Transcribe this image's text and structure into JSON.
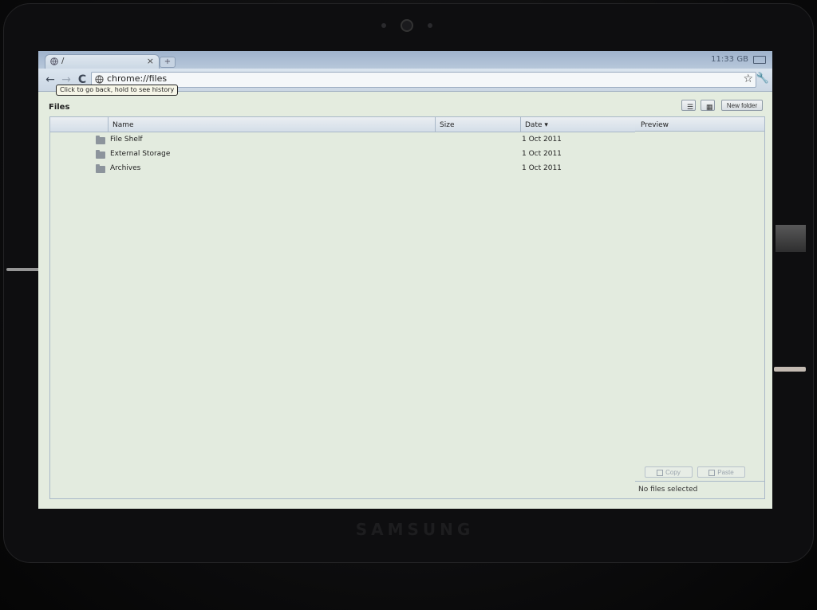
{
  "browser": {
    "tab": {
      "title": "/",
      "close_glyph": "×",
      "newtab_glyph": "+"
    },
    "status": {
      "time": "11:33",
      "network": "GB"
    },
    "toolbar": {
      "back_glyph": "←",
      "forward_glyph": "→",
      "reload_glyph": "C",
      "star_glyph": "☆",
      "wrench_glyph": "🔧"
    },
    "url": "chrome://files",
    "tooltip": "Click to go back, hold to see history"
  },
  "files": {
    "title": "Files",
    "list_view_glyph": "☰",
    "grid_view_glyph": "▦",
    "new_folder_label": "New folder",
    "columns": {
      "name": "Name",
      "size": "Size",
      "date": "Date ▾"
    },
    "items": [
      {
        "name": "File Shelf",
        "size": "",
        "date": "1 Oct 2011",
        "icon": "folder-icon"
      },
      {
        "name": "External Storage",
        "size": "",
        "date": "1 Oct 2011",
        "icon": "folder-icon"
      },
      {
        "name": "Archives",
        "size": "",
        "date": "1 Oct 2011",
        "icon": "folder-icon"
      }
    ],
    "preview": {
      "title": "Preview",
      "copy_label": "Copy",
      "paste_label": "Paste",
      "status": "No files selected"
    }
  },
  "device": {
    "brand": "SAMSUNG"
  },
  "colors": {
    "accent": "#a9b8c8",
    "background": "#e3ebdf",
    "bezel": "#0e0e10"
  }
}
